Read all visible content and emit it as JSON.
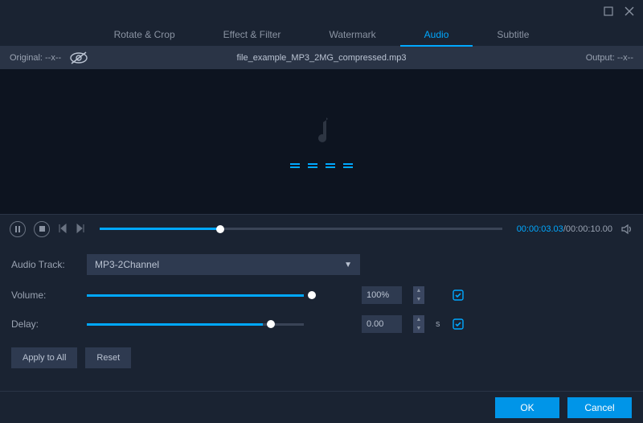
{
  "window": {
    "tabs": [
      "Rotate & Crop",
      "Effect & Filter",
      "Watermark",
      "Audio",
      "Subtitle"
    ],
    "active_tab": 3
  },
  "infobar": {
    "original_label": "Original: --x--",
    "filename": "file_example_MP3_2MG_compressed.mp3",
    "output_label": "Output: --x--"
  },
  "playback": {
    "progress_pct": 30,
    "time_current": "00:00:03.03",
    "time_total": "00:00:10.00"
  },
  "settings": {
    "audio_track_label": "Audio Track:",
    "audio_track_value": "MP3-2Channel",
    "volume_label": "Volume:",
    "volume_value": "100%",
    "volume_pct": 100,
    "delay_label": "Delay:",
    "delay_value": "0.00",
    "delay_unit": "s",
    "delay_pct": 81
  },
  "buttons": {
    "apply_all": "Apply to All",
    "reset": "Reset",
    "ok": "OK",
    "cancel": "Cancel"
  }
}
